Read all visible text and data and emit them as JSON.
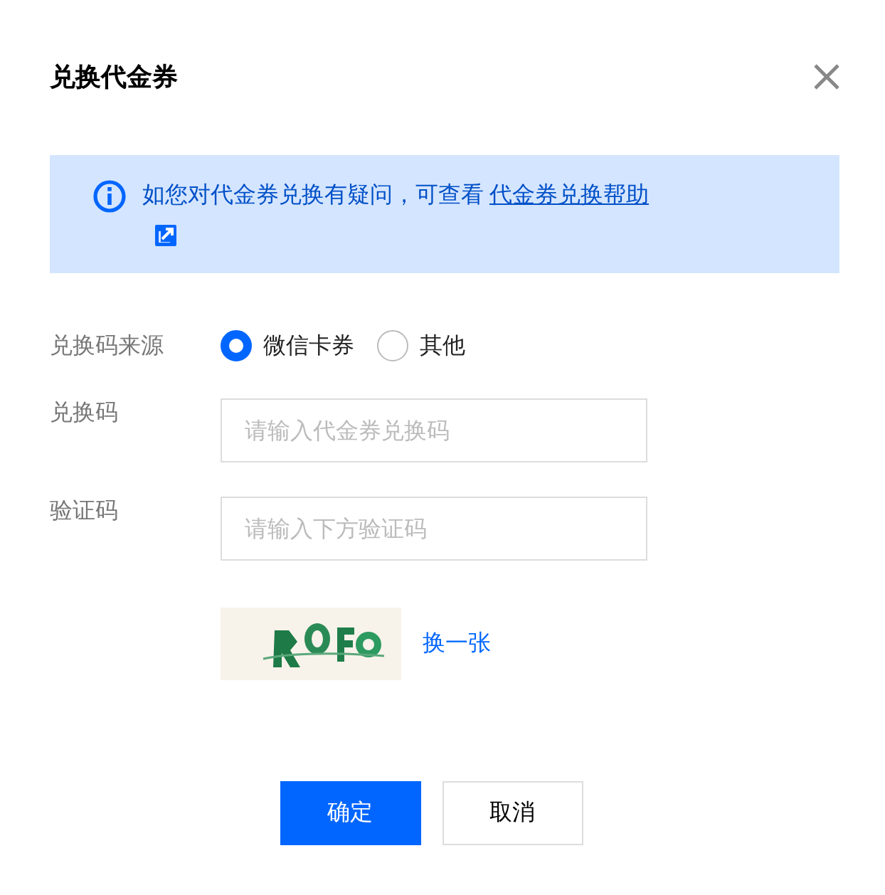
{
  "dialog": {
    "title": "兑换代金券"
  },
  "notice": {
    "text": "如您对代金券兑换有疑问，可查看",
    "link": "代金券兑换帮助"
  },
  "form": {
    "source": {
      "label": "兑换码来源",
      "options": [
        {
          "label": "微信卡券",
          "selected": true
        },
        {
          "label": "其他",
          "selected": false
        }
      ]
    },
    "fields": [
      {
        "label": "兑换码",
        "placeholder": "请输入代金券兑换码"
      },
      {
        "label": "验证码",
        "placeholder": "请输入下方验证码"
      }
    ],
    "refresh_link": "换一张"
  },
  "buttons": [
    {
      "label": "确定",
      "kind": "primary"
    },
    {
      "label": "取消",
      "kind": "secondary"
    }
  ]
}
